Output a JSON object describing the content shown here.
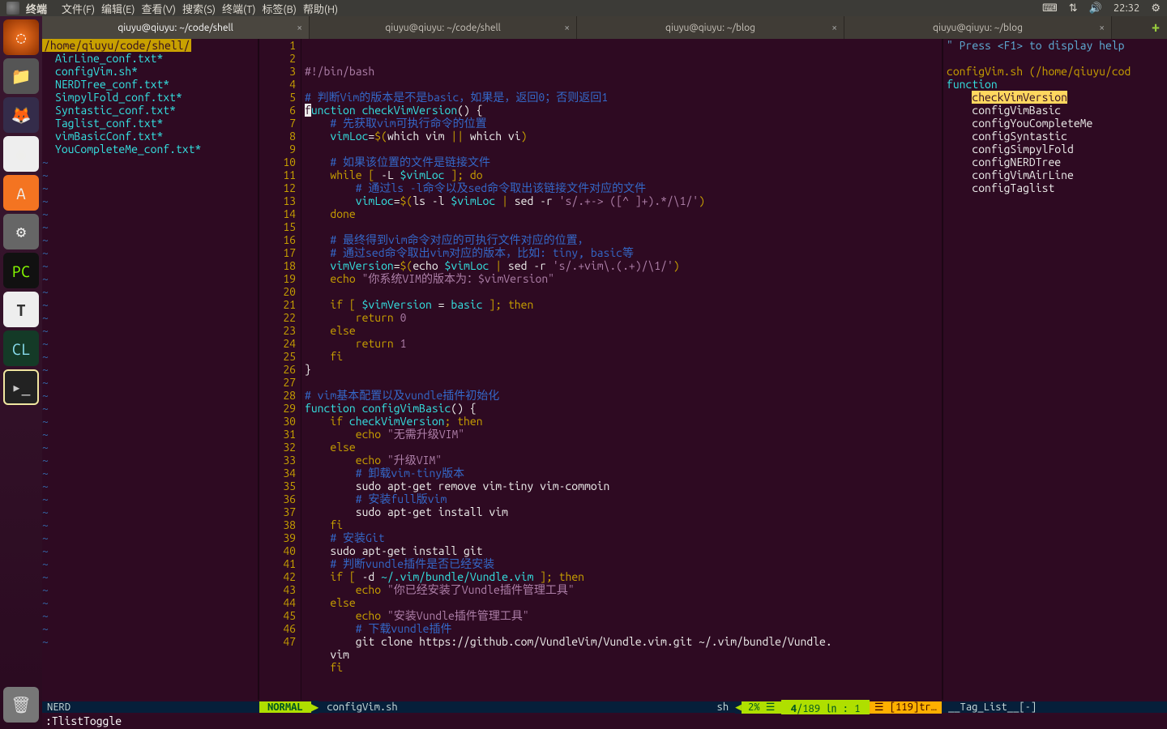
{
  "menubar": {
    "app": "终端",
    "items": [
      "文件(F)",
      "编辑(E)",
      "查看(V)",
      "搜索(S)",
      "终端(T)",
      "标签(B)",
      "帮助(H)"
    ],
    "time": "22:32"
  },
  "window": {
    "title": "qiuyu@qiuyu: ~/code/shell"
  },
  "tabs": [
    {
      "label": "qiuyu@qiuyu: ~/code/shell",
      "active": true
    },
    {
      "label": "qiuyu@qiuyu: ~/code/shell",
      "active": false
    },
    {
      "label": "qiuyu@qiuyu: ~/blog",
      "active": false
    },
    {
      "label": "qiuyu@qiuyu: ~/blog",
      "active": false
    }
  ],
  "nerdtree": {
    "path": "/home/qiuyu/code/shell/",
    "files": [
      "AirLine_conf.txt*",
      "configVim.sh*",
      "NERDTree_conf.txt*",
      "SimpylFold_conf.txt*",
      "Syntastic_conf.txt*",
      "Taglist_conf.txt*",
      "vimBasicConf.txt*",
      "YouCompleteMe_conf.txt*"
    ]
  },
  "code": {
    "first_line": 1,
    "lines": [
      [
        [
          "c-str",
          "#!/bin/bash"
        ]
      ],
      [],
      [
        [
          "c-com",
          "# 判断Vim的版本是不是basic，如果是，返回0；否则返回1"
        ]
      ],
      [
        [
          "cursor",
          "f"
        ],
        [
          "c-kw",
          "unction"
        ],
        [
          "c-op",
          " "
        ],
        [
          "c-var",
          "checkVimVersion"
        ],
        [
          "c-op",
          "() {"
        ]
      ],
      [
        [
          "c-op",
          "    "
        ],
        [
          "c-com",
          "# 先获取vim可执行命令的位置"
        ]
      ],
      [
        [
          "c-op",
          "    "
        ],
        [
          "c-var",
          "vimLoc"
        ],
        [
          "c-op",
          "="
        ],
        [
          "c-ylw",
          "$("
        ],
        [
          "c-cmd",
          "which vim "
        ],
        [
          "c-ylw",
          "||"
        ],
        [
          "c-cmd",
          " which vi"
        ],
        [
          "c-ylw",
          ")"
        ]
      ],
      [],
      [
        [
          "c-op",
          "    "
        ],
        [
          "c-com",
          "# 如果该位置的文件是链接文件"
        ]
      ],
      [
        [
          "c-op",
          "    "
        ],
        [
          "c-ylw",
          "while ["
        ],
        [
          "c-op",
          " -L "
        ],
        [
          "c-var",
          "$vimLoc"
        ],
        [
          "c-op",
          " "
        ],
        [
          "c-ylw",
          "];"
        ],
        [
          "c-op",
          " "
        ],
        [
          "c-ylw",
          "do"
        ]
      ],
      [
        [
          "c-op",
          "        "
        ],
        [
          "c-com",
          "# 通过ls -l命令以及sed命令取出该链接文件对应的文件"
        ]
      ],
      [
        [
          "c-op",
          "        "
        ],
        [
          "c-var",
          "vimLoc"
        ],
        [
          "c-op",
          "="
        ],
        [
          "c-ylw",
          "$("
        ],
        [
          "c-cmd",
          "ls -l "
        ],
        [
          "c-var",
          "$vimLoc"
        ],
        [
          "c-cmd",
          " "
        ],
        [
          "c-ylw",
          "|"
        ],
        [
          "c-cmd",
          " sed -r "
        ],
        [
          "c-str",
          "'s/.+-> ([^ ]+).*/\\1/'"
        ],
        [
          "c-ylw",
          ")"
        ]
      ],
      [
        [
          "c-op",
          "    "
        ],
        [
          "c-ylw",
          "done"
        ]
      ],
      [],
      [
        [
          "c-op",
          "    "
        ],
        [
          "c-com",
          "# 最终得到vim命令对应的可执行文件对应的位置，"
        ]
      ],
      [
        [
          "c-op",
          "    "
        ],
        [
          "c-com",
          "# 通过sed命令取出vim对应的版本，比如: tiny, basic等"
        ]
      ],
      [
        [
          "c-op",
          "    "
        ],
        [
          "c-var",
          "vimVersion"
        ],
        [
          "c-op",
          "="
        ],
        [
          "c-ylw",
          "$("
        ],
        [
          "c-cmd",
          "echo "
        ],
        [
          "c-var",
          "$vimLoc"
        ],
        [
          "c-cmd",
          " "
        ],
        [
          "c-ylw",
          "|"
        ],
        [
          "c-cmd",
          " sed -r "
        ],
        [
          "c-str",
          "'s/.+vim\\.(.+)/\\1/'"
        ],
        [
          "c-ylw",
          ")"
        ]
      ],
      [
        [
          "c-op",
          "    "
        ],
        [
          "c-ylw",
          "echo "
        ],
        [
          "c-str",
          "\"你系统VIM的版本为：$vimVersion\""
        ]
      ],
      [],
      [
        [
          "c-op",
          "    "
        ],
        [
          "c-ylw",
          "if ["
        ],
        [
          "c-op",
          " "
        ],
        [
          "c-var",
          "$vimVersion"
        ],
        [
          "c-op",
          " = "
        ],
        [
          "c-var",
          "basic"
        ],
        [
          "c-op",
          " "
        ],
        [
          "c-ylw",
          "]; then"
        ]
      ],
      [
        [
          "c-op",
          "        "
        ],
        [
          "c-ylw",
          "return "
        ],
        [
          "c-num",
          "0"
        ]
      ],
      [
        [
          "c-op",
          "    "
        ],
        [
          "c-ylw",
          "else"
        ]
      ],
      [
        [
          "c-op",
          "        "
        ],
        [
          "c-ylw",
          "return "
        ],
        [
          "c-num",
          "1"
        ]
      ],
      [
        [
          "c-op",
          "    "
        ],
        [
          "c-ylw",
          "fi"
        ]
      ],
      [
        [
          "c-op",
          "}"
        ]
      ],
      [],
      [
        [
          "c-com",
          "# vim基本配置以及vundle插件初始化"
        ]
      ],
      [
        [
          "c-kw",
          "function"
        ],
        [
          "c-op",
          " "
        ],
        [
          "c-var",
          "configVimBasic"
        ],
        [
          "c-op",
          "() {"
        ]
      ],
      [
        [
          "c-op",
          "    "
        ],
        [
          "c-ylw",
          "if"
        ],
        [
          "c-op",
          " "
        ],
        [
          "c-var",
          "checkVimVersion"
        ],
        [
          "c-ylw",
          "; then"
        ]
      ],
      [
        [
          "c-op",
          "        "
        ],
        [
          "c-ylw",
          "echo "
        ],
        [
          "c-str",
          "\"无需升级VIM\""
        ]
      ],
      [
        [
          "c-op",
          "    "
        ],
        [
          "c-ylw",
          "else"
        ]
      ],
      [
        [
          "c-op",
          "        "
        ],
        [
          "c-ylw",
          "echo "
        ],
        [
          "c-str",
          "\"升级VIM\""
        ]
      ],
      [
        [
          "c-op",
          "        "
        ],
        [
          "c-com",
          "# 卸载vim-tiny版本"
        ]
      ],
      [
        [
          "c-op",
          "        "
        ],
        [
          "c-cmd",
          "sudo apt-get remove vim-tiny vim-commoin"
        ]
      ],
      [
        [
          "c-op",
          "        "
        ],
        [
          "c-com",
          "# 安装full版vim"
        ]
      ],
      [
        [
          "c-op",
          "        "
        ],
        [
          "c-cmd",
          "sudo apt-get install vim"
        ]
      ],
      [
        [
          "c-op",
          "    "
        ],
        [
          "c-ylw",
          "fi"
        ]
      ],
      [
        [
          "c-op",
          "    "
        ],
        [
          "c-com",
          "# 安装Git"
        ]
      ],
      [
        [
          "c-op",
          "    "
        ],
        [
          "c-cmd",
          "sudo apt-get install git"
        ]
      ],
      [
        [
          "c-op",
          "    "
        ],
        [
          "c-com",
          "# 判断vundle插件是否已经安装"
        ]
      ],
      [
        [
          "c-op",
          "    "
        ],
        [
          "c-ylw",
          "if ["
        ],
        [
          "c-op",
          " -d "
        ],
        [
          "c-var",
          "~/.vim/bundle/Vundle.vim"
        ],
        [
          "c-op",
          " "
        ],
        [
          "c-ylw",
          "]; then"
        ]
      ],
      [
        [
          "c-op",
          "        "
        ],
        [
          "c-ylw",
          "echo "
        ],
        [
          "c-str",
          "\"你已经安装了Vundle插件管理工具\""
        ]
      ],
      [
        [
          "c-op",
          "    "
        ],
        [
          "c-ylw",
          "else"
        ]
      ],
      [
        [
          "c-op",
          "        "
        ],
        [
          "c-ylw",
          "echo "
        ],
        [
          "c-str",
          "\"安装Vundle插件管理工具\""
        ]
      ],
      [
        [
          "c-op",
          "        "
        ],
        [
          "c-com",
          "# 下载vundle插件"
        ]
      ],
      [
        [
          "c-op",
          "        "
        ],
        [
          "c-cmd",
          "git clone https://github.com/VundleVim/Vundle.vim.git ~/.vim/bundle/Vundle."
        ]
      ],
      [
        [
          "c-op",
          "    "
        ],
        [
          "c-cmd",
          "vim"
        ]
      ],
      [
        [
          "c-op",
          "    "
        ],
        [
          "c-ylw",
          "fi"
        ]
      ]
    ]
  },
  "taglist": {
    "hint": "\" Press <F1> to display help",
    "header": "configVim.sh (/home/qiuyu/cod",
    "section": "function",
    "tags": [
      {
        "name": "checkVimVersion",
        "hl": true
      },
      {
        "name": "configVimBasic"
      },
      {
        "name": "configYouCompleteMe"
      },
      {
        "name": "configSyntastic"
      },
      {
        "name": "configSimpylFold"
      },
      {
        "name": "configNERDTree"
      },
      {
        "name": "configVimAirLine"
      },
      {
        "name": "configTaglist"
      }
    ]
  },
  "status": {
    "nerd": "NERD",
    "mode": "NORMAL",
    "file": "configVim.sh",
    "ft": "sh",
    "pct": "2%",
    "ruler_line": "4",
    "ruler_total": "189",
    "col": "1",
    "trailing": "☰ [119]tr…",
    "tagwin": "__Tag_List__[-]"
  },
  "cmdline": ":TlistToggle"
}
